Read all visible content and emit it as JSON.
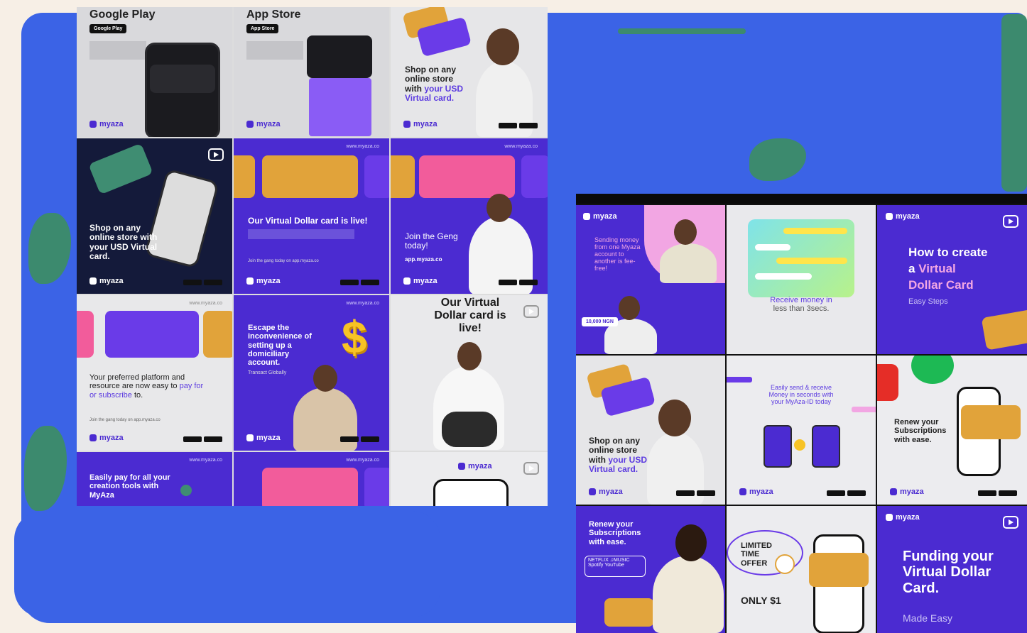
{
  "brand": "myaza",
  "colors": {
    "background": "#f7efe6",
    "canvas_blue": "#3b63e6",
    "brand_purple": "#4b2bd1",
    "leaf_green": "#3c8a6e",
    "card_gold": "#e1a33a",
    "card_pink": "#f25c9b"
  },
  "left_grid": {
    "tiles": [
      {
        "id": "google-play",
        "heading": "Google Play",
        "badge": "Google Play",
        "logo": "myaza"
      },
      {
        "id": "app-store",
        "heading": "App Store",
        "badge": "App Store",
        "logo": "myaza"
      },
      {
        "id": "shop-usd",
        "line1": "Shop on any",
        "line2": "online store",
        "line3_prefix": "with ",
        "line3_highlight": "your USD",
        "line4_highlight": "Virtual card.",
        "logo": "myaza"
      },
      {
        "id": "shop-usd-dark",
        "heading": "Shop on any online store with your USD Virtual card.",
        "logo": "myaza"
      },
      {
        "id": "card-live",
        "url": "www.myaza.co",
        "heading": "Our Virtual Dollar card is live!",
        "cta": "Join the gang today on app.myaza.co",
        "logo": "myaza"
      },
      {
        "id": "join-geng",
        "url": "www.myaza.co",
        "heading": "Join the Geng today!",
        "sub": "app.myaza.co",
        "logo": "myaza"
      },
      {
        "id": "preferred-platform",
        "url": "www.myaza.co",
        "heading_prefix": "Your preferred platform and resource are now easy to ",
        "heading_highlight": "pay for or subscribe",
        "heading_suffix": " to.",
        "cta": "Join the gang today on app.myaza.co",
        "logo": "myaza"
      },
      {
        "id": "escape",
        "url": "www.myaza.co",
        "heading": "Escape the inconvenience of setting up a domiciliary account.",
        "sub": "Transact Globally",
        "logo": "myaza"
      },
      {
        "id": "card-live-2",
        "heading": "Our Virtual Dollar card is live!"
      },
      {
        "id": "pay-creation",
        "url": "www.myaza.co",
        "heading": "Easily pay for all your creation tools with MyAza"
      },
      {
        "id": "partial-pink",
        "url": "www.myaza.co"
      },
      {
        "id": "partial-phone",
        "logo": "myaza"
      }
    ]
  },
  "right_grid": {
    "tiles": [
      {
        "id": "send-money",
        "logo": "myaza",
        "heading": "Sending money from one Myaza account to another is fee-free!",
        "amount": "10,000 NGN"
      },
      {
        "id": "receive-money",
        "heading_highlight": "Receive money in",
        "heading": "less than 3secs."
      },
      {
        "id": "how-to",
        "logo": "myaza",
        "line1": "How to create",
        "line2_prefix": "a ",
        "line2_highlight": "Virtual",
        "line3_highlight": "Dollar Card",
        "sub": "Easy Steps"
      },
      {
        "id": "shop-usd-2",
        "line1": "Shop on any",
        "line2": "online store",
        "line3_prefix": "with ",
        "line3_highlight": "your USD",
        "line4_highlight": "Virtual card.",
        "logo": "myaza"
      },
      {
        "id": "easily-send",
        "heading": "Easily send & receive Money in seconds with your MyAza-ID today",
        "logo": "myaza"
      },
      {
        "id": "renew-subs",
        "heading": "Renew your Subscriptions with ease.",
        "logo": "myaza"
      },
      {
        "id": "renew-subs-2",
        "heading": "Renew your Subscriptions with ease.",
        "brands": "NETFLIX  ♫MUSIC",
        "brands2": "Spotify  YouTube"
      },
      {
        "id": "limited-offer",
        "offer": "LIMITED TIME OFFER",
        "price": "ONLY $1"
      },
      {
        "id": "funding",
        "logo": "myaza",
        "heading": "Funding your Virtual Dollar Card.",
        "sub": "Made Easy"
      }
    ]
  }
}
